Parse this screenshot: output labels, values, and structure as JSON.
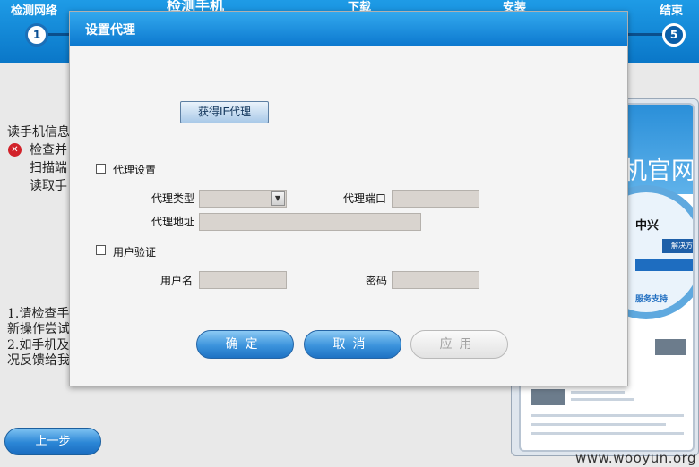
{
  "steps": {
    "labels": [
      "检测网络",
      "检测手机",
      "下载",
      "安装",
      "结束"
    ],
    "first_number": "1",
    "last_number": "5"
  },
  "background": {
    "info_title": "读手机信息",
    "info_lines": [
      "检查并",
      "扫描端",
      "读取手"
    ],
    "tips": [
      "1.请检查手",
      "新操作尝试",
      "2.如手机及",
      "况反馈给我"
    ],
    "prev_button": "上一步",
    "preview": {
      "banner": "机官网",
      "brand": "中兴",
      "tab": "解决方案",
      "support": "服务支持"
    },
    "watermark": "www.wooyun.org"
  },
  "dialog": {
    "title": "设置代理",
    "ie_proxy_button": "获得IE代理",
    "proxy_settings_label": "代理设置",
    "proxy_type_label": "代理类型",
    "proxy_type_value": "",
    "proxy_port_label": "代理端口",
    "proxy_port_value": "",
    "proxy_address_label": "代理地址",
    "proxy_address_value": "",
    "user_auth_label": "用户验证",
    "username_label": "用户名",
    "username_value": "",
    "password_label": "密码",
    "password_value": "",
    "ok_button": "确定",
    "cancel_button": "取消",
    "apply_button": "应用"
  },
  "colors": {
    "title_bar": "#1a8ee0",
    "primary_button": "#2b86d6",
    "disabled_field": "#d9d4cf",
    "error_icon": "#d2222a"
  }
}
